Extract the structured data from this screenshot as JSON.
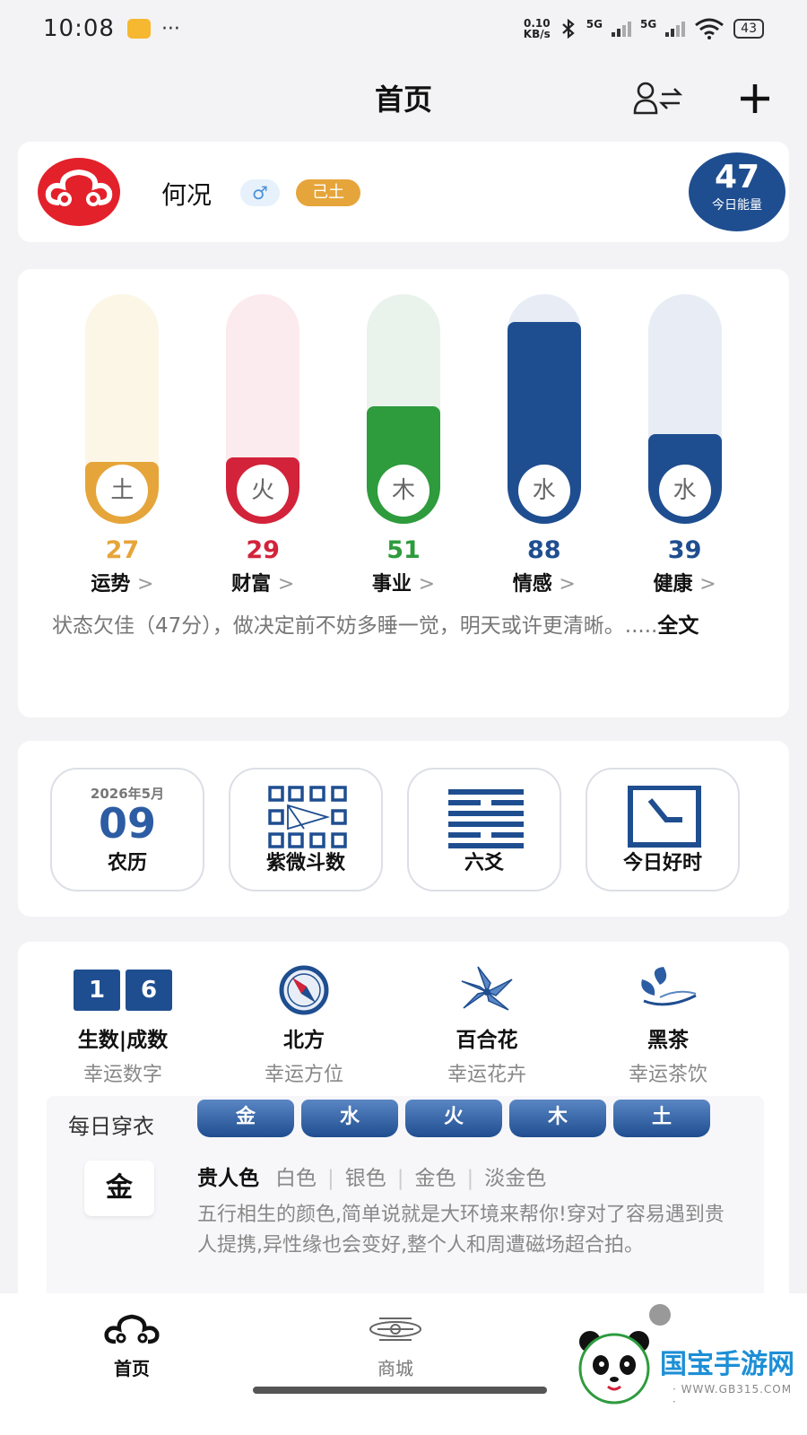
{
  "status_bar": {
    "time": "10:08",
    "more": "···",
    "speed_value": "0.10",
    "speed_unit": "KB/s",
    "network_1": "5G",
    "network_2": "5G",
    "battery": "43"
  },
  "header": {
    "title": "首页"
  },
  "profile": {
    "name": "何况",
    "gender_symbol": "♂",
    "element": "己土",
    "energy_value": "47",
    "energy_label": "今日能量"
  },
  "fortune": {
    "items": [
      {
        "element": "土",
        "value": "27",
        "level": 0.27,
        "label": "运势",
        "color": "#e6a53a",
        "track": "#fcf6e7"
      },
      {
        "element": "火",
        "value": "29",
        "level": 0.29,
        "label": "财富",
        "color": "#d2233a",
        "track": "#fcebee"
      },
      {
        "element": "木",
        "value": "51",
        "level": 0.51,
        "label": "事业",
        "color": "#2e9b3d",
        "track": "#e9f3eb"
      },
      {
        "element": "水",
        "value": "88",
        "level": 0.88,
        "label": "情感",
        "color": "#1f4e90",
        "track": "#e8edf5"
      },
      {
        "element": "水",
        "value": "39",
        "level": 0.39,
        "label": "健康",
        "color": "#1f4e90",
        "track": "#e8edf5"
      }
    ],
    "chevron": ">",
    "status_text": "状态欠佳（47分），做决定前不妨多睡一觉，明天或许更清晰。.....",
    "full_text_link": "全文"
  },
  "tools": {
    "calendar_date": "2026年5月",
    "calendar_day": "09",
    "calendar_label": "农历",
    "ziwei_label": "紫微斗数",
    "liuyao_label": "六爻",
    "good_time_label": "今日好时"
  },
  "lucky": {
    "number_1": "1",
    "number_2": "6",
    "number_value": "生数|成数",
    "number_label": "幸运数字",
    "direction_value": "北方",
    "direction_label": "幸运方位",
    "flower_value": "百合花",
    "flower_label": "幸运花卉",
    "tea_value": "黑茶",
    "tea_label": "幸运茶饮"
  },
  "dress": {
    "title": "每日穿衣",
    "tabs": [
      "金",
      "水",
      "火",
      "木",
      "土"
    ],
    "active": "金",
    "color_label": "贵人色",
    "colors": [
      "白色",
      "银色",
      "金色",
      "淡金色"
    ],
    "description": "五行相生的颜色,简单说就是大环境来帮你!穿对了容易遇到贵人提携,异性缘也会变好,整个人和周遭磁场超合拍。"
  },
  "nav": {
    "home_label": "首页",
    "shop_label": "商城"
  },
  "watermark": {
    "text": "国宝手游网",
    "url": "· WWW.GB315.COM ·"
  }
}
